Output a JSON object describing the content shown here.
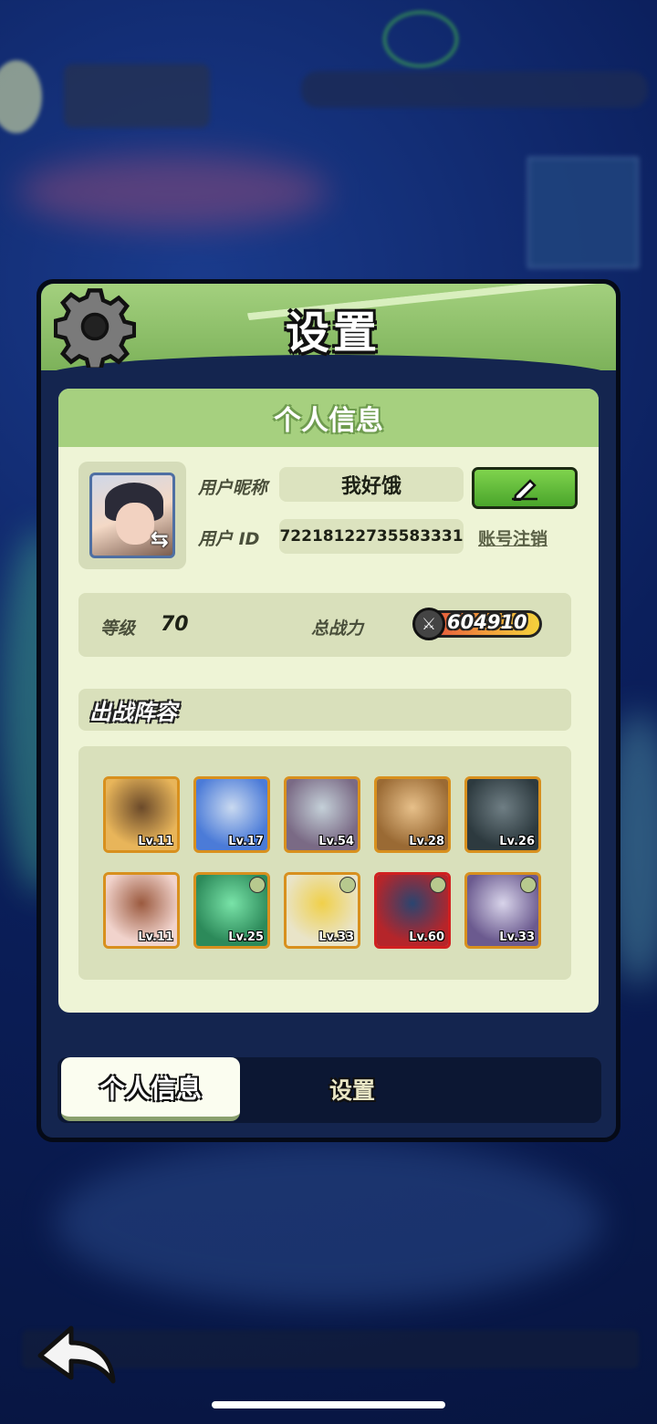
{
  "panel": {
    "title": "设置",
    "section_title": "个人信息"
  },
  "profile": {
    "nickname_label": "用户昵称",
    "nickname": "我好饿",
    "id_label": "用户 ID",
    "user_id": "72218122735583331",
    "cancel_account": "账号注销"
  },
  "stats": {
    "level_label": "等级",
    "level": "70",
    "power_label": "总战力",
    "power": "604910"
  },
  "lineup": {
    "title": "出战阵容",
    "heroes": [
      {
        "level": "Lv.11",
        "colors": [
          "#e8b55a",
          "#6b4a2a"
        ]
      },
      {
        "level": "Lv.17",
        "colors": [
          "#4b7bd8",
          "#c9d9f0"
        ]
      },
      {
        "level": "Lv.54",
        "colors": [
          "#7a6a85",
          "#c4d0d8"
        ]
      },
      {
        "level": "Lv.28",
        "colors": [
          "#9a6a34",
          "#e7c08a"
        ]
      },
      {
        "level": "Lv.26",
        "colors": [
          "#2d3a3f",
          "#6f7e84"
        ]
      },
      {
        "level": "Lv.11",
        "colors": [
          "#f1d3cc",
          "#9b5a3f"
        ]
      },
      {
        "level": "Lv.25",
        "colors": [
          "#2c8a5a",
          "#79e3a8"
        ]
      },
      {
        "level": "Lv.33",
        "colors": [
          "#e9e4c8",
          "#f0d04a"
        ]
      },
      {
        "level": "Lv.60",
        "colors": [
          "#b5252a",
          "#2a4570"
        ]
      },
      {
        "level": "Lv.33",
        "colors": [
          "#6b5a8f",
          "#d8d4ea"
        ]
      }
    ]
  },
  "tabs": {
    "active": "个人信息",
    "inactive": "设置"
  }
}
